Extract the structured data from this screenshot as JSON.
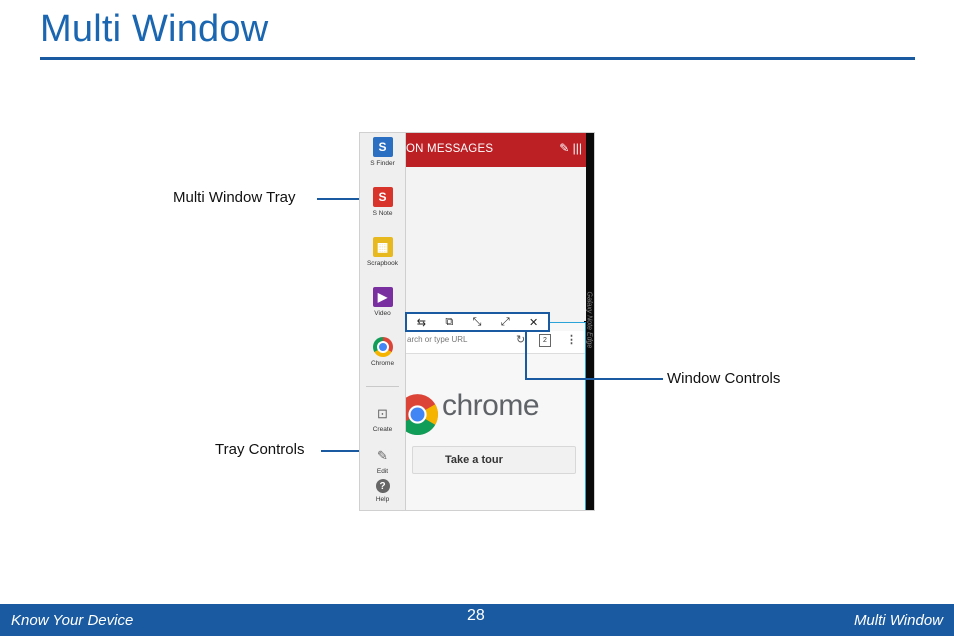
{
  "page": {
    "title": "Multi Window"
  },
  "screenshot": {
    "tray_items": [
      {
        "label": "S Finder",
        "icon": "search-icon",
        "color": "#2a6fc2",
        "glyph": "S"
      },
      {
        "label": "S Note",
        "icon": "s-note-icon",
        "color": "#d9342b",
        "glyph": "S"
      },
      {
        "label": "Scrapbook",
        "icon": "scrapbook-icon",
        "color": "#e8b81f",
        "glyph": "▦"
      },
      {
        "label": "Video",
        "icon": "play-icon",
        "color": "#7a2fa0",
        "glyph": "▶"
      },
      {
        "label": "Chrome",
        "icon": "chrome-icon",
        "color": "#4285f4",
        "glyph": ""
      }
    ],
    "tray_controls": [
      {
        "label": "Create",
        "icon": "create-icon",
        "glyph": "⊡"
      },
      {
        "label": "Edit",
        "icon": "pencil-icon",
        "glyph": "✎"
      },
      {
        "label": "Help",
        "icon": "help-icon",
        "glyph": "?"
      }
    ],
    "messages_header": "ON MESSAGES",
    "side_label": "Galaxy Note Edge",
    "url_placeholder": "arch or type URL",
    "tab_count": "2",
    "chrome_word": "chrome",
    "tour_button": "Take a tour",
    "window_controls": [
      {
        "icon": "swap-icon",
        "glyph": "⇆"
      },
      {
        "icon": "drag-content-icon",
        "glyph": "⧉"
      },
      {
        "icon": "minimize-icon",
        "glyph": "⤡"
      },
      {
        "icon": "maximize-icon",
        "glyph": "⤢"
      },
      {
        "icon": "close-icon",
        "glyph": "✕"
      }
    ]
  },
  "callouts": {
    "tray": "Multi Window Tray",
    "window_controls": "Window Controls",
    "tray_controls": "Tray Controls"
  },
  "footer": {
    "left": "Know Your Device",
    "page_number": "28",
    "right": "Multi Window"
  },
  "colors": {
    "accent": "#1a5aa0",
    "header_red": "#bc2025"
  }
}
